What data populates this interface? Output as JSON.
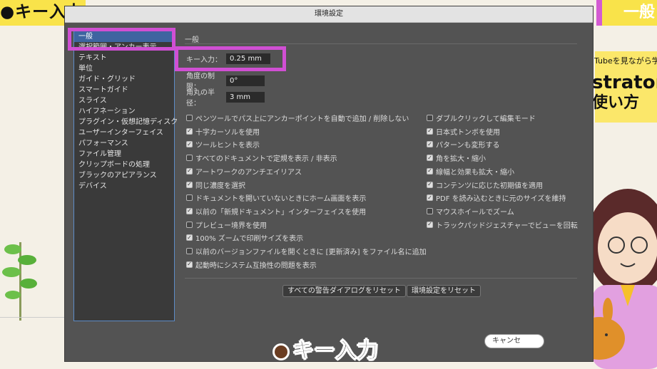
{
  "overlay": {
    "top_left_caption": "●キー入力",
    "top_right_caption": "一般",
    "bottom_caption": "キー入力",
    "right_panel_line1": "Tubeを見ながら学べる",
    "right_panel_line2": "stratorの",
    "right_panel_line3": "使い方"
  },
  "dialog": {
    "title": "環境設定",
    "section_title": "一般",
    "fields": {
      "key_increment_label": "キー入力：",
      "key_increment_value": "0.25 mm",
      "constrain_angle_label": "角度の制限：",
      "constrain_angle_value": "0°",
      "corner_radius_label": "角丸の半径：",
      "corner_radius_value": "3 mm"
    },
    "sidebar": [
      {
        "label": "一般",
        "selected": true
      },
      {
        "label": "選択範囲・アンカー表示",
        "selected": false
      },
      {
        "label": "テキスト",
        "selected": false
      },
      {
        "label": "単位",
        "selected": false
      },
      {
        "label": "ガイド・グリッド",
        "selected": false
      },
      {
        "label": "スマートガイド",
        "selected": false
      },
      {
        "label": "スライス",
        "selected": false
      },
      {
        "label": "ハイフネーション",
        "selected": false
      },
      {
        "label": "プラグイン・仮想記憶ディスク",
        "selected": false
      },
      {
        "label": "ユーザーインターフェイス",
        "selected": false
      },
      {
        "label": "パフォーマンス",
        "selected": false
      },
      {
        "label": "ファイル管理",
        "selected": false
      },
      {
        "label": "クリップボードの処理",
        "selected": false
      },
      {
        "label": "ブラックのアピアランス",
        "selected": false
      },
      {
        "label": "デバイス",
        "selected": false
      }
    ],
    "left_options": [
      {
        "label": "ペンツールでパス上にアンカーポイントを自動で追加 / 削除しない",
        "checked": false
      },
      {
        "label": "十字カーソルを使用",
        "checked": true
      },
      {
        "label": "ツールヒントを表示",
        "checked": true
      },
      {
        "label": "すべてのドキュメントで定規を表示 / 非表示",
        "checked": false
      },
      {
        "label": "アートワークのアンチエイリアス",
        "checked": true
      },
      {
        "label": "同じ濃度を選択",
        "checked": true
      },
      {
        "label": "ドキュメントを開いていないときにホーム画面を表示",
        "checked": false
      },
      {
        "label": "以前の「新規ドキュメント」インターフェイスを使用",
        "checked": true
      },
      {
        "label": "プレビュー境界を使用",
        "checked": false
      },
      {
        "label": "100% ズームで印刷サイズを表示",
        "checked": true
      },
      {
        "label": "以前のバージョンファイルを開くときに [更新済み] をファイル名に追加",
        "checked": false
      },
      {
        "label": "起動時にシステム互換性の問題を表示",
        "checked": true
      }
    ],
    "right_options": [
      {
        "label": "ダブルクリックして編集モード",
        "checked": false
      },
      {
        "label": "日本式トンボを使用",
        "checked": true
      },
      {
        "label": "パターンも変形する",
        "checked": true
      },
      {
        "label": "角を拡大・縮小",
        "checked": true
      },
      {
        "label": "線幅と効果も拡大・縮小",
        "checked": true
      },
      {
        "label": "コンテンツに応じた初期値を適用",
        "checked": true
      },
      {
        "label": "PDF を読み込むときに元のサイズを維持",
        "checked": true
      },
      {
        "label": "マウスホイールでズーム",
        "checked": false
      },
      {
        "label": "トラックパッドジェスチャーでビューを回転",
        "checked": true
      }
    ],
    "buttons": {
      "reset_warnings": "すべての警告ダイアログをリセット",
      "reset_prefs": "環境設定をリセット",
      "cancel": "キャンセ"
    }
  },
  "colors": {
    "highlight": "#d04fd3",
    "dialog_bg": "#535353",
    "selection": "#3e64a0"
  }
}
